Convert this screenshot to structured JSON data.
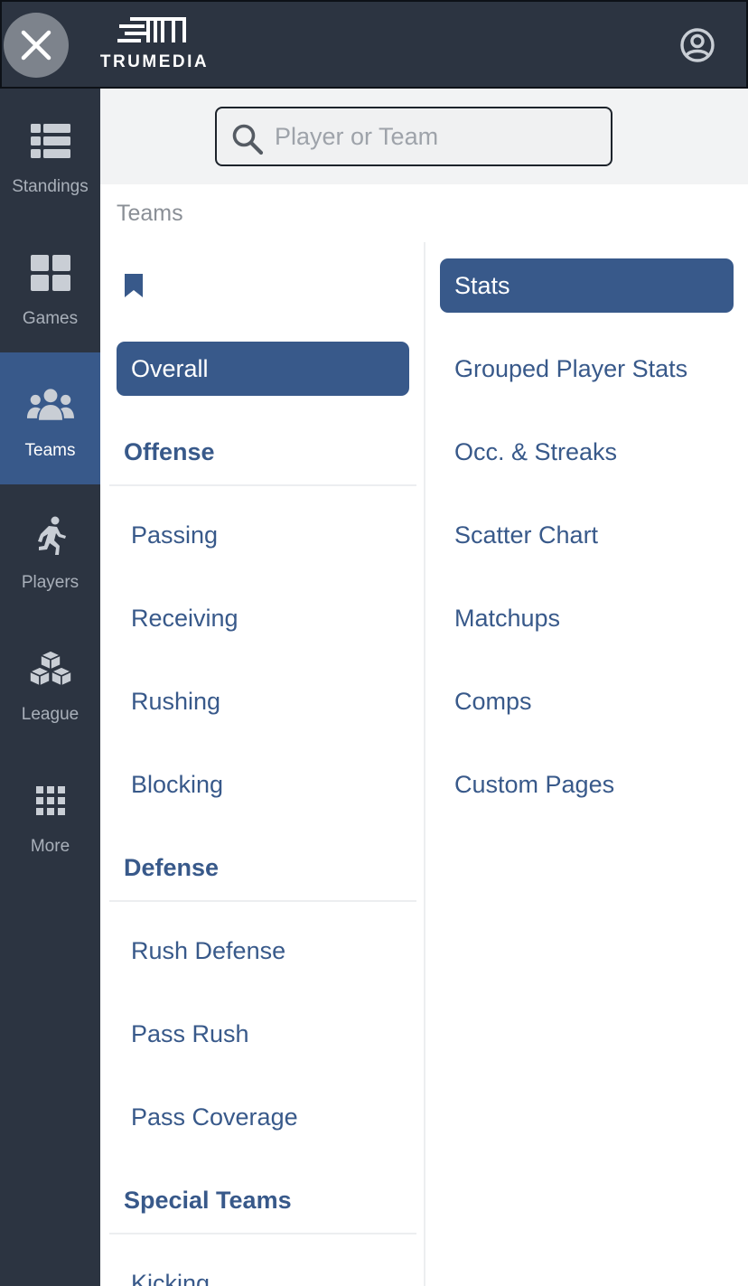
{
  "header": {
    "brand_name": "TRUMEDIA"
  },
  "sidebar": {
    "items": [
      {
        "label": "Standings",
        "icon": "standings-icon",
        "active": false
      },
      {
        "label": "Games",
        "icon": "games-grid-icon",
        "active": false
      },
      {
        "label": "Teams",
        "icon": "teams-group-icon",
        "active": true
      },
      {
        "label": "Players",
        "icon": "player-running-icon",
        "active": false
      },
      {
        "label": "League",
        "icon": "league-boxes-icon",
        "active": false
      },
      {
        "label": "More",
        "icon": "more-grid-icon",
        "active": false
      }
    ]
  },
  "search": {
    "placeholder": "Player or Team",
    "value": ""
  },
  "main": {
    "section_title": "Teams",
    "left_menu": {
      "overall_label": "Overall",
      "offense_header": "Offense",
      "offense_items": [
        "Passing",
        "Receiving",
        "Rushing",
        "Blocking"
      ],
      "defense_header": "Defense",
      "defense_items": [
        "Rush Defense",
        "Pass Rush",
        "Pass Coverage"
      ],
      "special_header": "Special Teams",
      "special_items": [
        "Kicking"
      ]
    },
    "right_menu": {
      "items": [
        "Stats",
        "Grouped Player Stats",
        "Occ. & Streaks",
        "Scatter Chart",
        "Matchups",
        "Comps",
        "Custom Pages"
      ],
      "active_index": 0
    }
  },
  "colors": {
    "nav_bg": "#2c3441",
    "accent": "#38598a",
    "link": "#38598a",
    "muted_text": "#a9b0ba"
  }
}
